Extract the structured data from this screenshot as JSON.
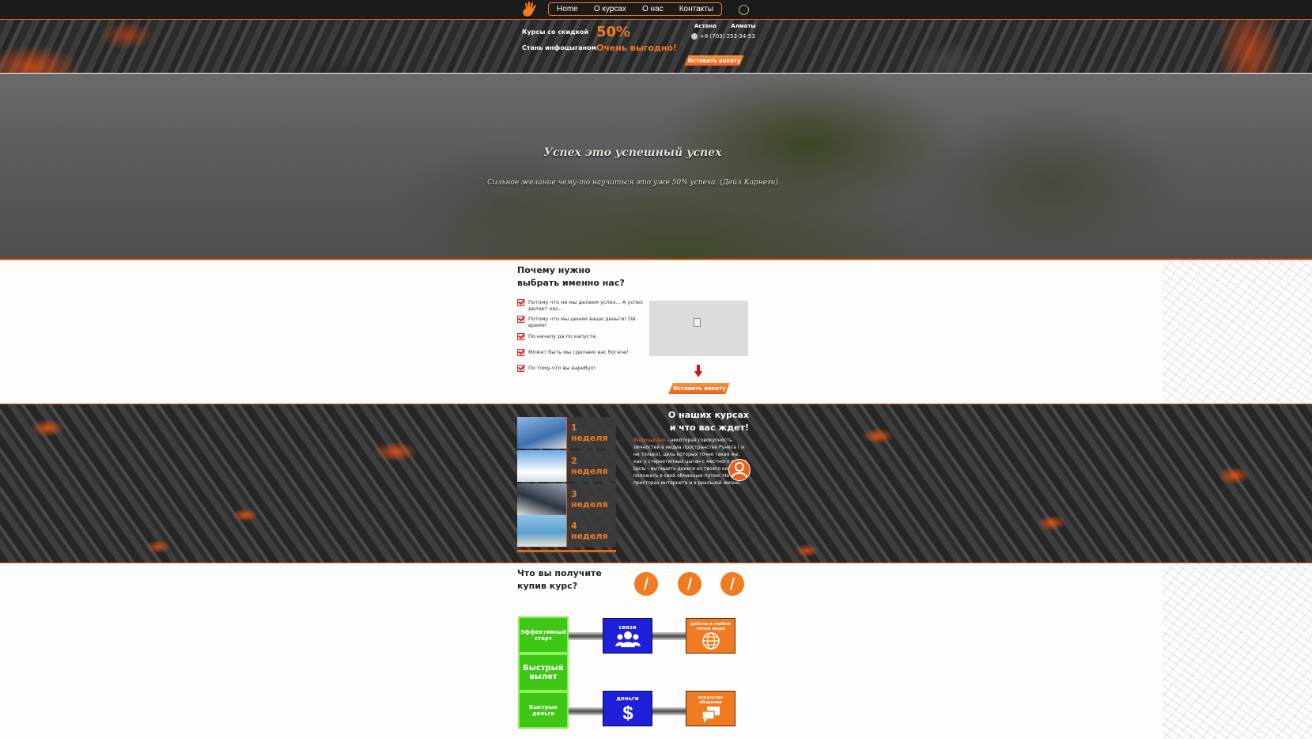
{
  "nav": {
    "items": [
      "Home",
      "О курсах",
      "О нас",
      "Контакты"
    ]
  },
  "header": {
    "line1": "Курсы со скидкой",
    "line2": "Стань инфоцыганом",
    "percent": "50%",
    "slogan": "Очень выгодно!",
    "city1": "Астана",
    "city2": "Алматы",
    "phone": "+8 (703) 253-34-53",
    "button": "Оставить анкету"
  },
  "hero": {
    "title": "Успех это успешный успех",
    "quote": "Сильное желание чему-то научиться это уже 50% успеха. (Дейл Карнеги)"
  },
  "why": {
    "title_line1": "Почему нужно",
    "title_line2": "выбрать именно нас?",
    "reasons": [
      "Потому что не мы делаем успех... А успех делает нас...",
      "Потому что мы ценим ваши деньги! Ой время!",
      "По началу да по капусте.",
      "Может быть мы сделаем вас богаче!",
      "По тому-что вы вареВух!"
    ],
    "button": "Оставить анкету"
  },
  "courses": {
    "title_line1": "О наших курсах",
    "title_line2": "и что вас ждет!",
    "weeks": [
      "1 неделя",
      "2 неделя",
      "3 неделя",
      "4 неделя"
    ],
    "highlight": "Инфоцыгане",
    "text": " - некоторая совокупность личностей в медиа пространстве Рунета ( и не только), цель которых точно такая же, как у стереотипных цыган с местного рынка. Цель - вытащить деньги из твоего кармана и положить в свой обманным путем. На просторах интернета и в реальной жизни."
  },
  "get": {
    "title_line1": "Что вы получите",
    "title_line2": "купив курс?",
    "green_tiles": [
      "Эффективный старт",
      "Быстрый вылет",
      "Быстрые деньги"
    ],
    "blue_tiles": [
      "связи",
      "деньги"
    ],
    "orange_tiles": [
      "работа в любой точке мира",
      "искусство общения"
    ]
  },
  "colors": {
    "accent": "#e8641e",
    "green": "#3fc716",
    "blue": "#1d20d6"
  }
}
